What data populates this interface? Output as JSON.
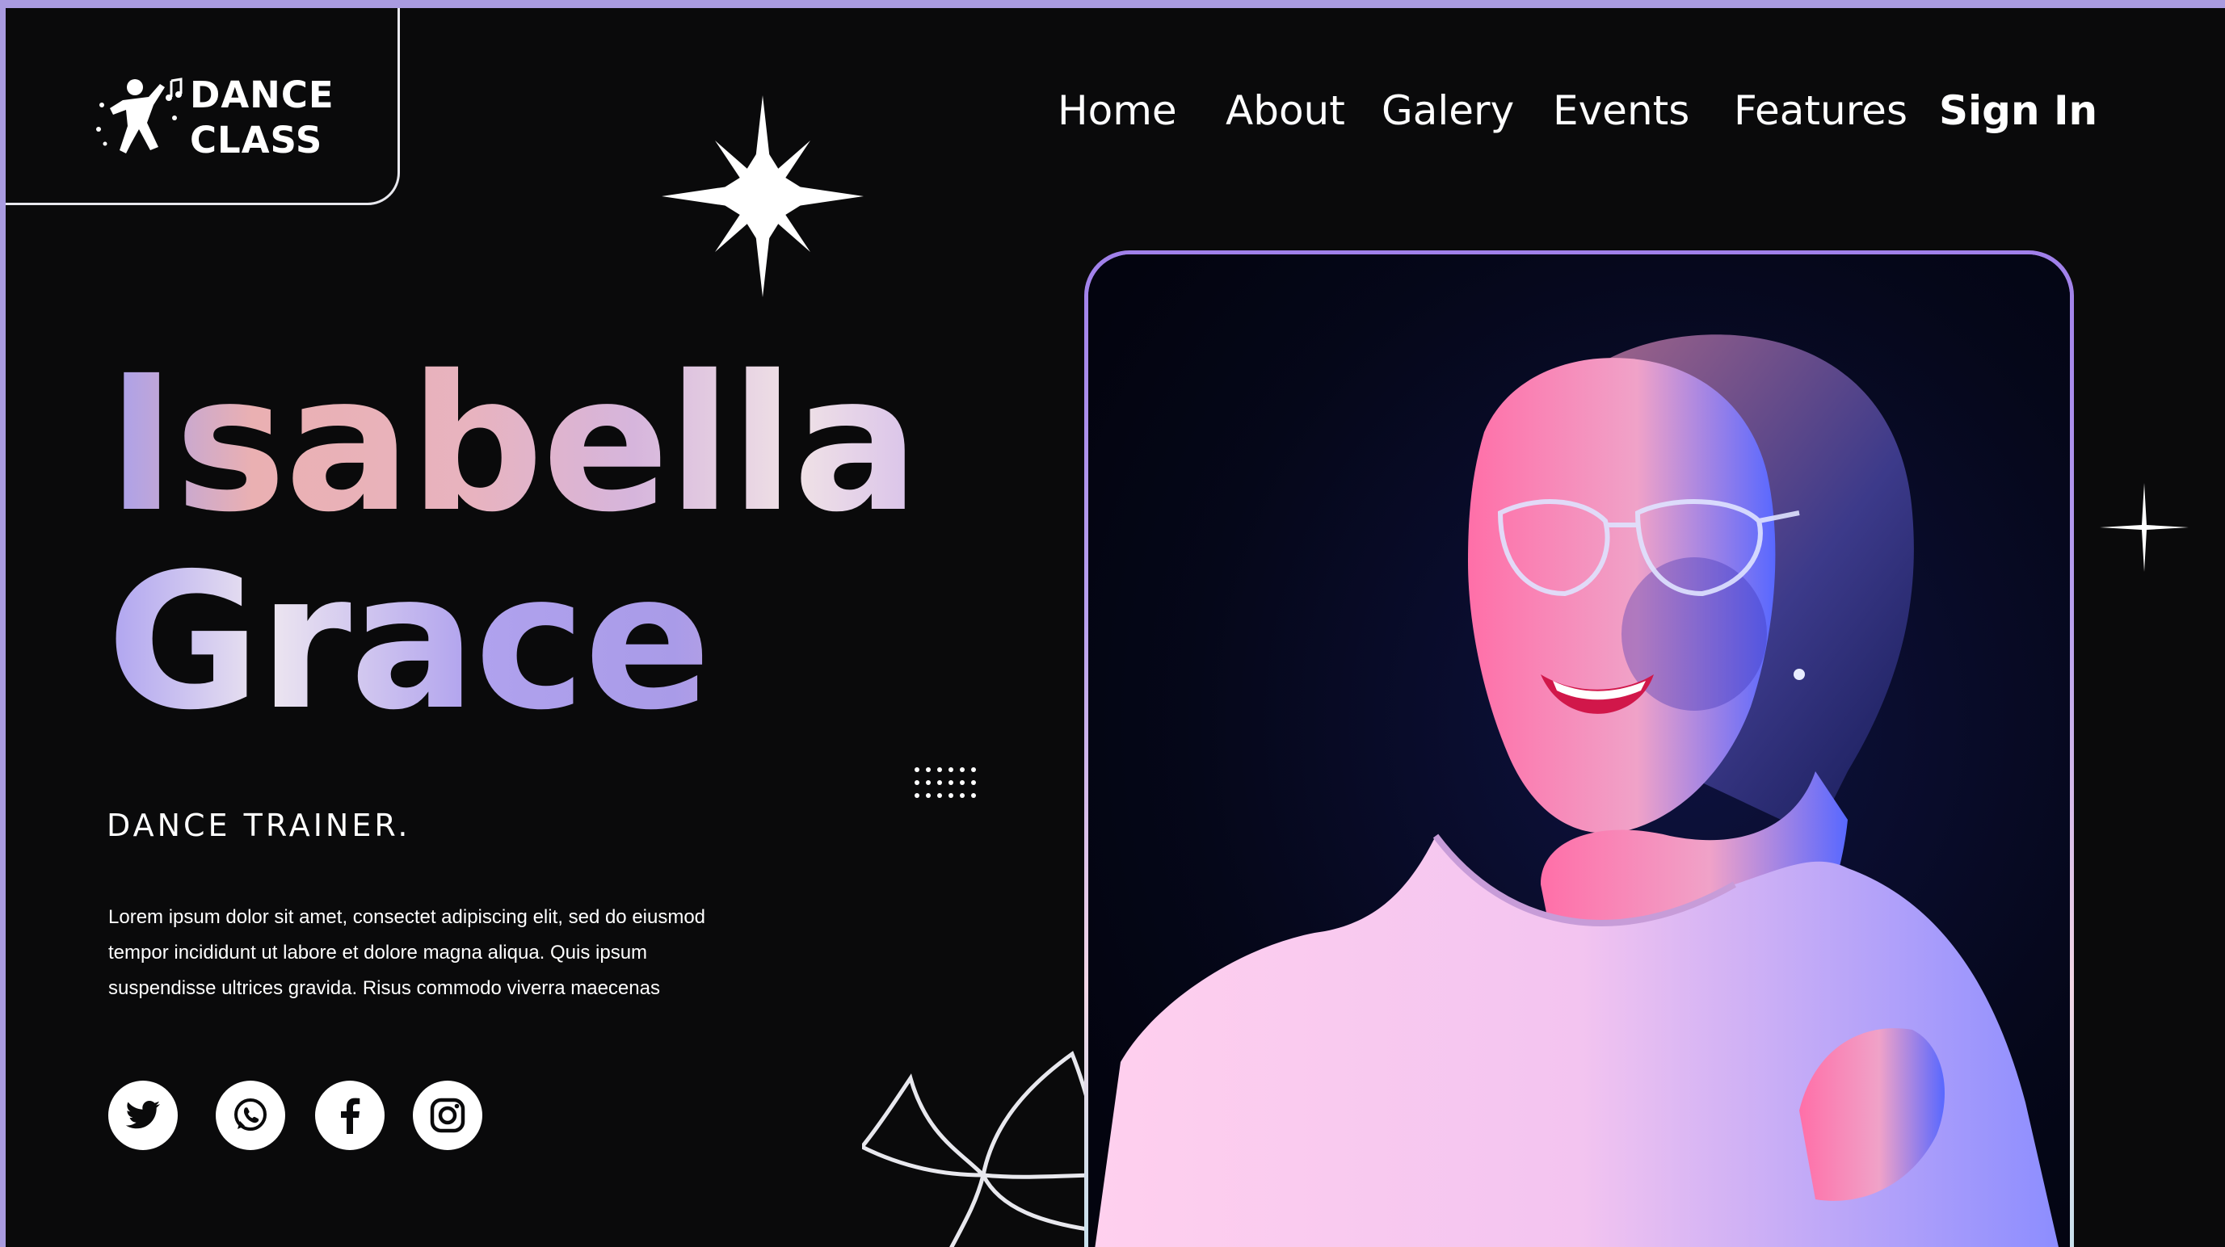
{
  "brand": {
    "line1": "DANCE",
    "line2": "CLASS",
    "icon": "dancer-icon"
  },
  "nav": {
    "items": [
      {
        "label": "Home"
      },
      {
        "label": "About"
      },
      {
        "label": "Galery"
      },
      {
        "label": "Events"
      },
      {
        "label": "Features"
      }
    ],
    "signin": "Sign In"
  },
  "hero": {
    "first_name": "Isabella",
    "last_name": "Grace",
    "role": "DANCE TRAINER.",
    "description_lines": [
      "Lorem ipsum dolor sit amet, consectet adipiscing elit, sed do eiusmod",
      "tempor incididunt ut labore et dolore magna aliqua. Quis ipsum",
      "suspendisse ultrices gravida. Risus commodo viverra maecenas"
    ]
  },
  "socials": [
    {
      "icon": "twitter-icon"
    },
    {
      "icon": "whatsapp-icon"
    },
    {
      "icon": "facebook-icon"
    },
    {
      "icon": "instagram-icon"
    }
  ],
  "decorations": [
    "eight-point-star-icon",
    "sparkle-icon",
    "dot-grid",
    "flower-outline"
  ],
  "colors": {
    "background": "#0a0a0b",
    "accent": "#a99be0",
    "text": "#ffffff"
  }
}
